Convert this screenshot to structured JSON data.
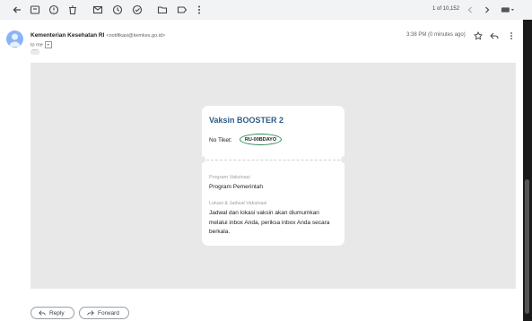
{
  "toolbar": {
    "icons": [
      "back-icon",
      "archive-icon",
      "report-spam-icon",
      "delete-icon",
      "mark-unread-icon",
      "snooze-icon",
      "add-task-icon",
      "move-to-icon",
      "label-icon",
      "more-icon"
    ],
    "pager": "1 of 10,152",
    "input_tools": "keyboard-icon"
  },
  "message": {
    "sender_name": "Kementerian Kesehatan RI",
    "sender_email": "<notifikasi@kemkes.go.id>",
    "to_label": "to me",
    "time": "3:38 PM (0 minutes ago)"
  },
  "card": {
    "title": "Vaksin BOOSTER 2",
    "ticket_label": "No Tiket:",
    "ticket_code": "RU-00BDAYO",
    "program_label": "Program Vaksinasi",
    "program_value": "Program Pemerintah",
    "location_label": "Lokasi & Jadwal Vaksinasi",
    "location_value": "Jadwal dan lokasi vaksin akan diumumkan melalui inbox Anda, periksa inbox Anda secara berkala."
  },
  "actions": {
    "reply_label": "Reply",
    "forward_label": "Forward"
  },
  "colors": {
    "title_blue": "#2f5c8a",
    "badge_green": "#2e8b57",
    "panel_grey": "#e8e8e8"
  }
}
